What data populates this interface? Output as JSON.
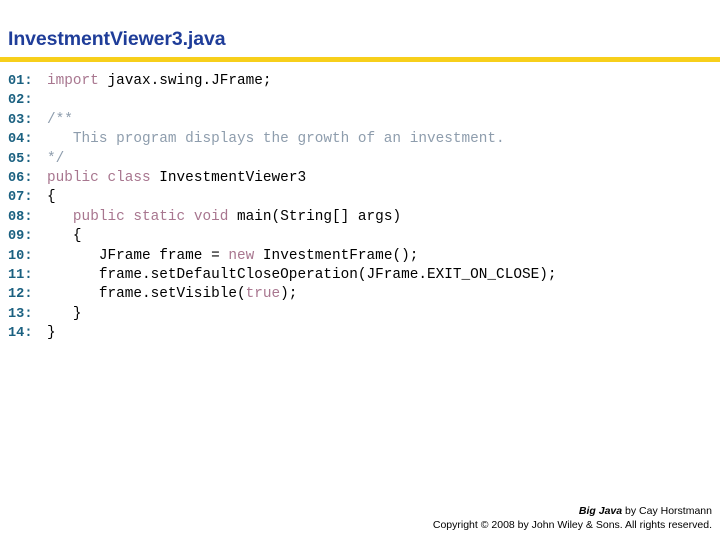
{
  "slide": {
    "title": "InvestmentViewer3.java",
    "title_color": "#1f3d99",
    "rule_color": "#f7cf1b"
  },
  "code": {
    "language": "java",
    "line_number_color": "#1a6080",
    "keyword_color": "#a8768f",
    "comment_color": "#8e9dad",
    "plain_color": "#000000",
    "lines": [
      {
        "number": "01:",
        "tokens": [
          {
            "text": "import",
            "type": "keyword"
          },
          {
            "text": " javax.swing.JFrame;",
            "type": "plain"
          }
        ]
      },
      {
        "number": "02:",
        "tokens": []
      },
      {
        "number": "03:",
        "tokens": [
          {
            "text": "/**",
            "type": "comment"
          }
        ]
      },
      {
        "number": "04:",
        "tokens": [
          {
            "text": "   This program displays the growth of an investment.",
            "type": "comment"
          }
        ]
      },
      {
        "number": "05:",
        "tokens": [
          {
            "text": "*/",
            "type": "comment"
          }
        ]
      },
      {
        "number": "06:",
        "tokens": [
          {
            "text": "public class",
            "type": "keyword"
          },
          {
            "text": " InvestmentViewer3",
            "type": "plain"
          }
        ]
      },
      {
        "number": "07:",
        "tokens": [
          {
            "text": "{",
            "type": "plain"
          }
        ]
      },
      {
        "number": "08:",
        "tokens": [
          {
            "text": "   ",
            "type": "plain"
          },
          {
            "text": "public static void",
            "type": "keyword"
          },
          {
            "text": " main(String[] args)",
            "type": "plain"
          }
        ]
      },
      {
        "number": "09:",
        "tokens": [
          {
            "text": "   {",
            "type": "plain"
          }
        ]
      },
      {
        "number": "10:",
        "tokens": [
          {
            "text": "      JFrame frame = ",
            "type": "plain"
          },
          {
            "text": "new",
            "type": "keyword"
          },
          {
            "text": " InvestmentFrame();",
            "type": "plain"
          }
        ]
      },
      {
        "number": "11:",
        "tokens": [
          {
            "text": "      frame.setDefaultCloseOperation(JFrame.EXIT_ON_CLOSE);",
            "type": "plain"
          }
        ]
      },
      {
        "number": "12:",
        "tokens": [
          {
            "text": "      frame.setVisible(",
            "type": "plain"
          },
          {
            "text": "true",
            "type": "keyword"
          },
          {
            "text": ");",
            "type": "plain"
          }
        ]
      },
      {
        "number": "13:",
        "tokens": [
          {
            "text": "   }",
            "type": "plain"
          }
        ]
      },
      {
        "number": "14:",
        "tokens": [
          {
            "text": "}",
            "type": "plain"
          }
        ]
      }
    ]
  },
  "footer": {
    "book_title": "Big Java",
    "attribution": " by Cay Horstmann",
    "copyright": "Copyright © 2008 by John Wiley & Sons.  All rights reserved."
  }
}
